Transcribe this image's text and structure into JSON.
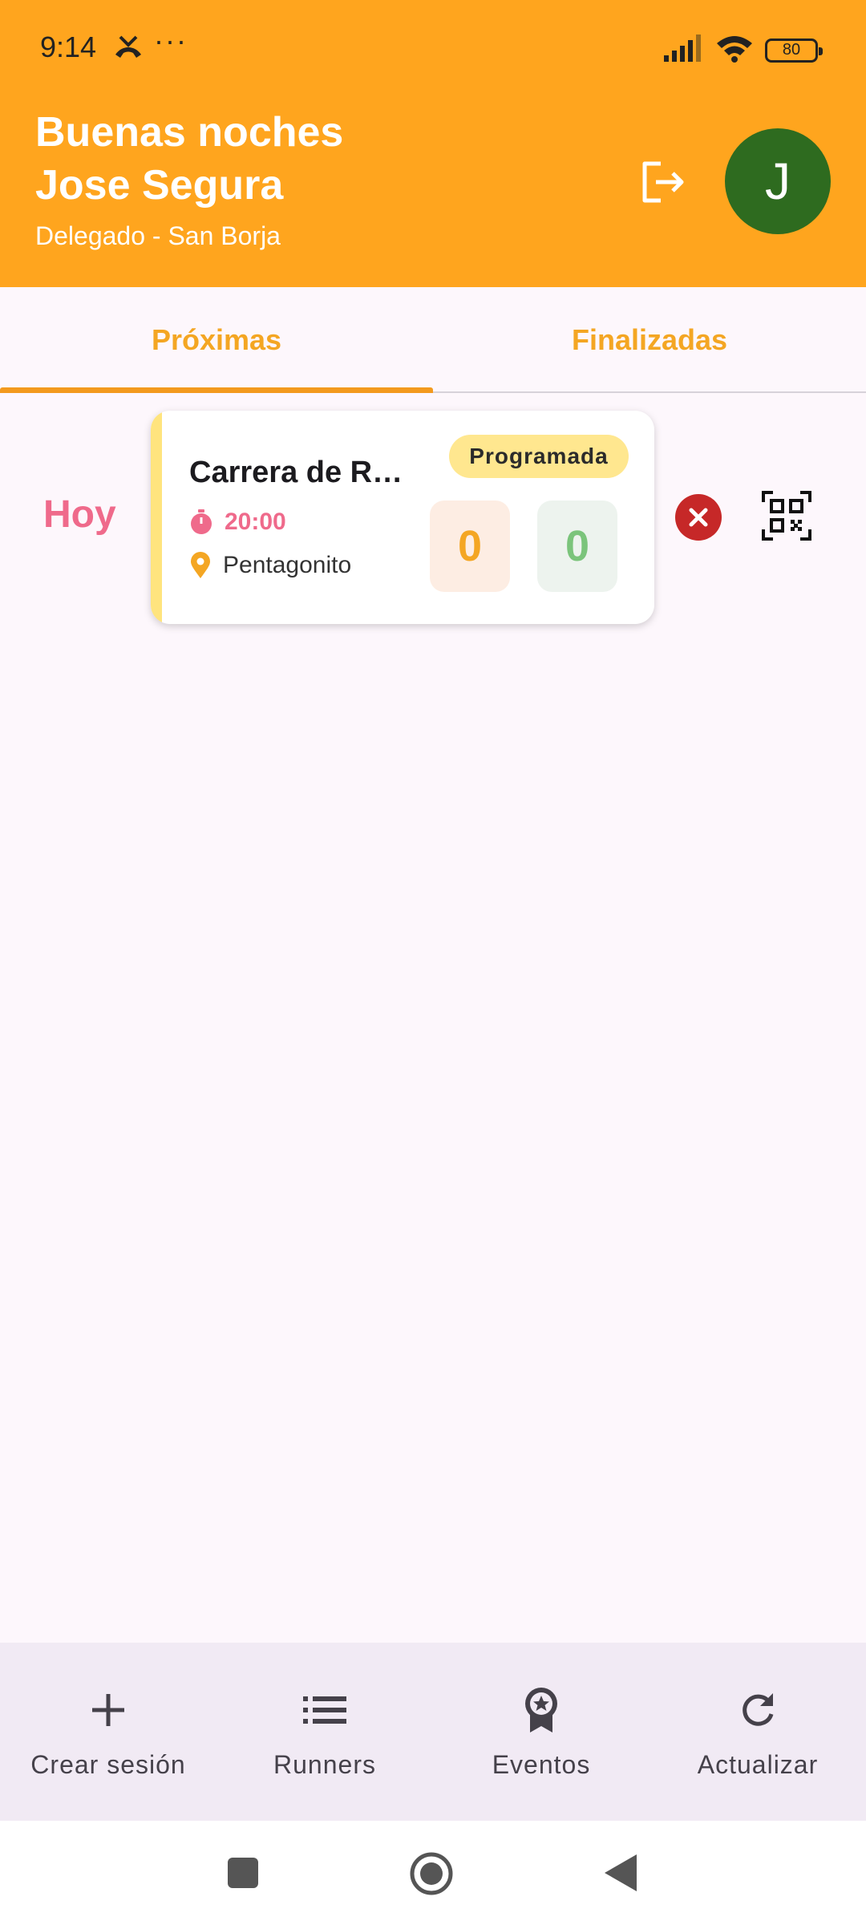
{
  "status_bar": {
    "time": "9:14",
    "dots": "···",
    "battery": "80"
  },
  "header": {
    "greeting_line1": "Buenas noches",
    "greeting_line2": "Jose Segura",
    "role": "Delegado - San Borja",
    "avatar_initial": "J",
    "accent_color": "#FFA51E"
  },
  "tabs": [
    {
      "label": "Próximas",
      "selected": true
    },
    {
      "label": "Finalizadas",
      "selected": false
    }
  ],
  "sessions": [
    {
      "day": "Hoy",
      "title": "Carrera de Re...",
      "time": "20:00",
      "place": "Pentagonito",
      "status": "Programada",
      "count_orange": "0",
      "count_green": "0"
    }
  ],
  "bottom_nav": [
    {
      "label": "Crear sesión",
      "icon": "plus-icon"
    },
    {
      "label": "Runners",
      "icon": "list-icon"
    },
    {
      "label": "Eventos",
      "icon": "award-icon"
    },
    {
      "label": "Actualizar",
      "icon": "refresh-icon"
    }
  ]
}
